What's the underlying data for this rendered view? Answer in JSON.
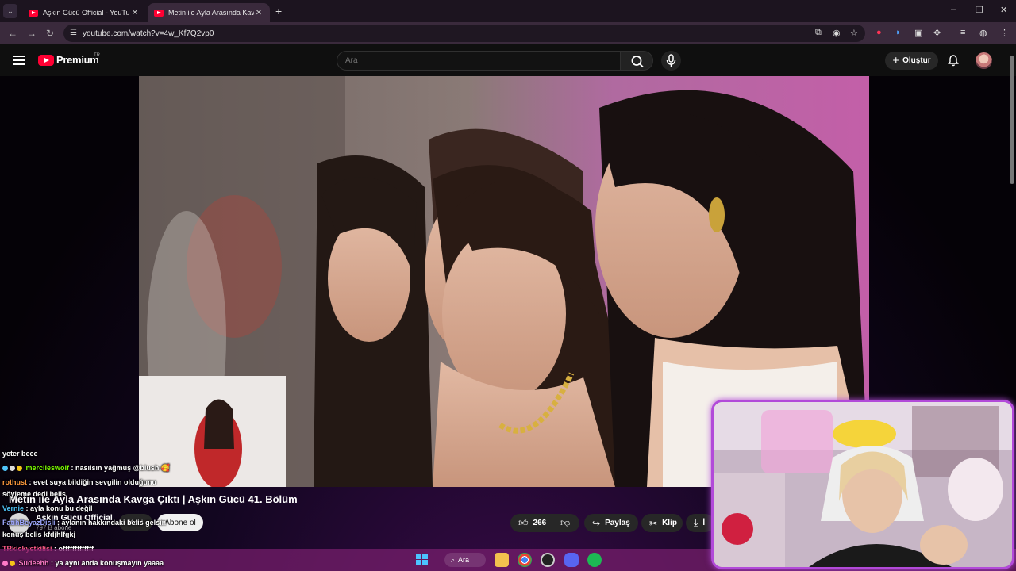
{
  "browser": {
    "tabs": [
      {
        "title": "Aşkın Gücü Official - YouTube",
        "active": false
      },
      {
        "title": "Metin ile Ayla Arasında Kavga Ç",
        "active": true
      }
    ],
    "new_tab": "+",
    "url": "youtube.com/watch?v=4w_Kf7Q2vp0"
  },
  "youtube": {
    "logo_text": "Premium",
    "country": "TR",
    "search_placeholder": "Ara",
    "create_label": "Oluştur"
  },
  "video": {
    "title": "Metin ile Ayla Arasında Kavga Çıktı | Aşkın Gücü 41. Bölüm",
    "channel": "Aşkın Gücü Official",
    "subscribers": "797 B abone",
    "join_label": "Katıl",
    "subscribe_label": "Abone ol",
    "likes": "266",
    "share_label": "Paylaş",
    "clip_label": "Klip",
    "download_label": "İ"
  },
  "chat": [
    {
      "user": "",
      "message": "yeter beee",
      "color": "#ffffff"
    },
    {
      "user": "mercileswolf",
      "message": " : nasılsın yağmuş @blush 🥰",
      "color": "#7cfc00"
    },
    {
      "user": "rothust",
      "message": " : evet suya bildiğin sevgilin olduğunu",
      "color": "#ff9a3d"
    },
    {
      "user": "",
      "message": "söyleme dedi belis",
      "color": "#ffffff"
    },
    {
      "user": "Vernie",
      "message": " : ayla konu bu değil",
      "color": "#4fc3f7"
    },
    {
      "user": "FatihBeyazDisli",
      "message": " : aylanın hakkındaki belis gelsin",
      "color": "#9fa8ff"
    },
    {
      "user": "",
      "message": "konuş belis kfdjhlfgkj",
      "color": "#ffffff"
    },
    {
      "user": "TRkickyetkilisi",
      "message": " : offfffffffffff",
      "color": "#ff5a8a"
    },
    {
      "user": "Sudeehh",
      "message": " : ya aynı anda konuşmayın yaaaa",
      "color": "#ff7ac8"
    }
  ],
  "taskbar": {
    "search_label": "Ara"
  },
  "colors": {
    "accent": "#ff0033",
    "cam_border": "#b24ad9",
    "taskbar": "#781e6e"
  }
}
